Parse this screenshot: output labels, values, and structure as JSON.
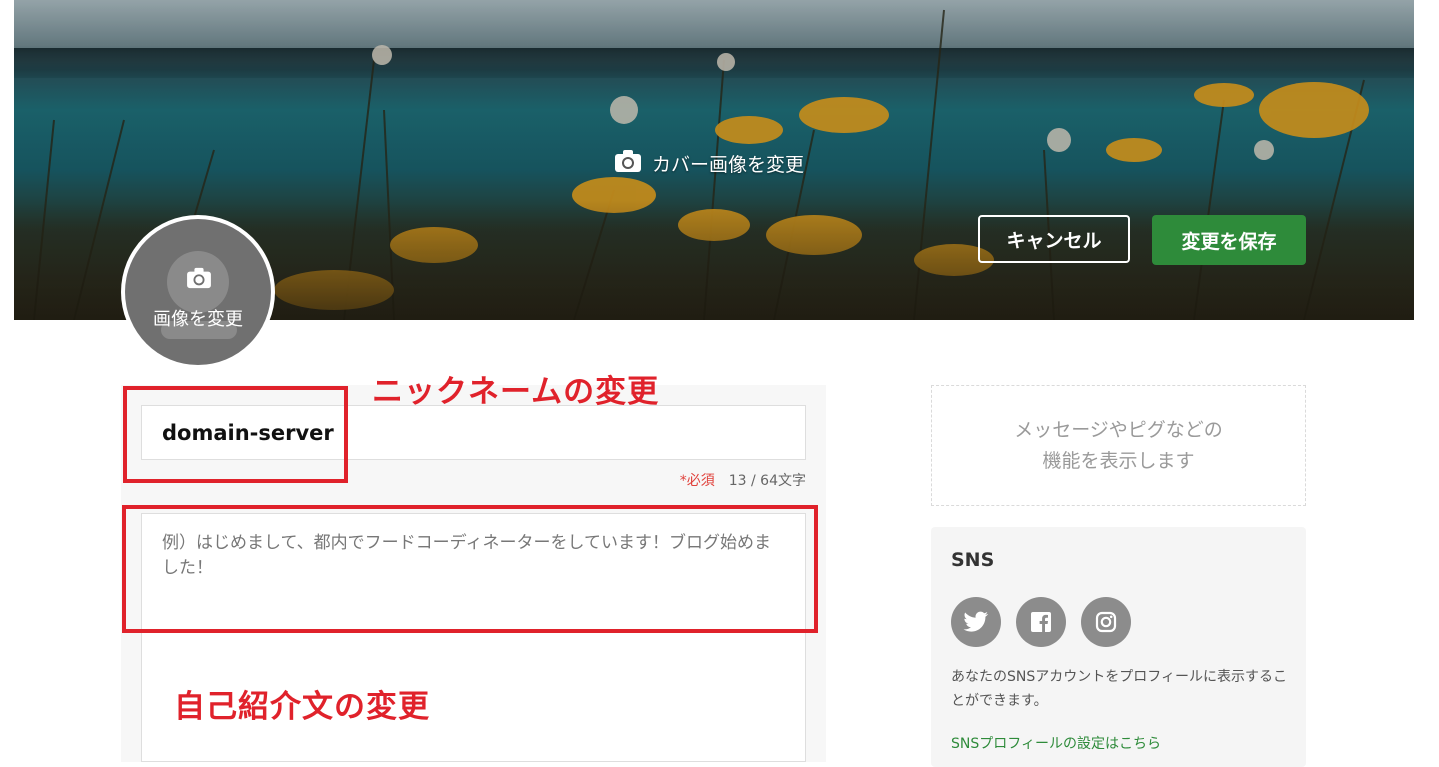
{
  "cover": {
    "change_label": "カバー画像を変更",
    "cancel_label": "キャンセル",
    "save_label": "変更を保存"
  },
  "avatar": {
    "change_label": "画像を変更"
  },
  "profile": {
    "nickname": "domain-server",
    "required_label": "*必須",
    "char_count": "13 / 64文字",
    "bio_placeholder": "例）はじめまして、都内でフードコーディネーターをしています！ブログ始めました！"
  },
  "annotations": {
    "nickname_label": "ニックネームの変更",
    "bio_label": "自己紹介文の変更",
    "color": "#e0222b"
  },
  "sidebar": {
    "message_placeholder_line1": "メッセージやピグなどの",
    "message_placeholder_line2": "機能を表示します",
    "sns": {
      "title": "SNS",
      "icons": [
        "twitter-icon",
        "facebook-icon",
        "instagram-icon"
      ],
      "description": "あなたのSNSアカウントをプロフィールに表示することができます。",
      "link_label": "SNSプロフィールの設定はこちら"
    }
  },
  "colors": {
    "accent_green": "#2e8b3a",
    "required_red": "#e0413b"
  }
}
